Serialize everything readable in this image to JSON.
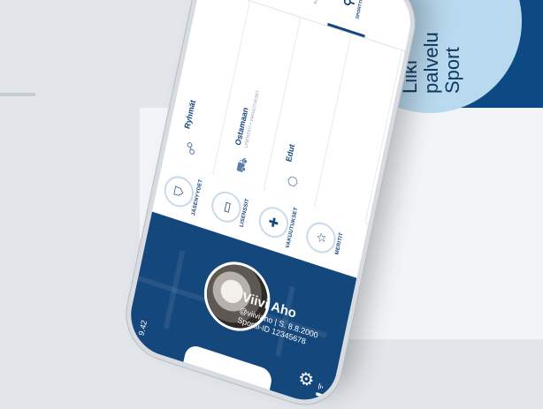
{
  "status_bar": {
    "time": "9.42",
    "signal_icon": "wifi-icon",
    "battery_icon": "battery-icon"
  },
  "header": {
    "settings_icon": "gear-icon"
  },
  "profile": {
    "name": "Viivi Aho",
    "meta": "@viiviaho | S. 8.8.2000",
    "sportti_id": "Sportti-ID 12345678",
    "avatar_icon": "avatar"
  },
  "tabs": [
    {
      "label": "JÄSENYYDET",
      "icon": "shield-person-icon",
      "glyph": "⛉"
    },
    {
      "label": "LISENSSIT",
      "icon": "id-card-icon",
      "glyph": "▭"
    },
    {
      "label": "VAKUUTUKSET",
      "icon": "plus-shield-icon",
      "glyph": "✚"
    },
    {
      "label": "MERITIT",
      "icon": "star-icon",
      "glyph": "☆"
    }
  ],
  "list": [
    {
      "title": "Ryhmät",
      "sub": "",
      "icon": "group-icon",
      "glyph": "☍"
    },
    {
      "title": "Ostamaan",
      "sub": "LISENSSIT • VAKUUTUKSET",
      "icon": "cart-icon",
      "glyph": "⛟"
    },
    {
      "title": "Edut",
      "sub": "",
      "icon": "tag-icon",
      "glyph": "⬡"
    },
    {
      "title": "",
      "sub": "",
      "icon": "",
      "glyph": ""
    }
  ],
  "bottom_nav": [
    {
      "label": "SPORTTITILI",
      "icon": "person-icon",
      "glyph": "⚲"
    },
    {
      "label": "KALENTERI",
      "icon": "calendar-icon",
      "glyph": "▦"
    }
  ],
  "promo": {
    "lines": [
      "Liikl",
      "palvelu",
      "Sport"
    ]
  },
  "colors": {
    "brand": "#14477c",
    "background_dark": "#0d4a84",
    "circle": "#b9d9ee"
  }
}
